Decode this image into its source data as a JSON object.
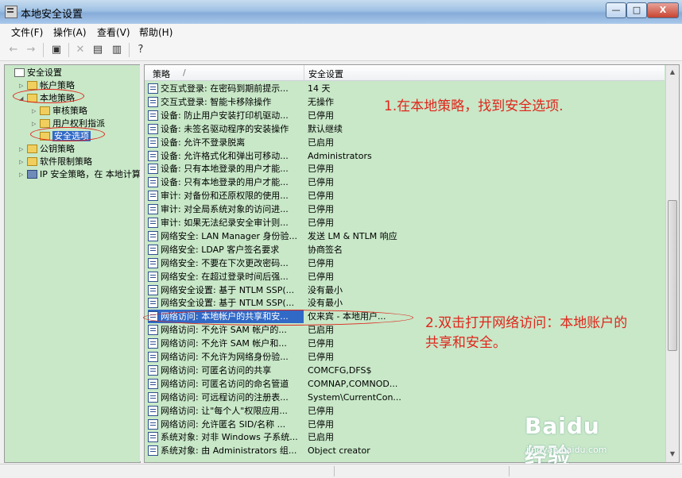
{
  "window": {
    "title": "本地安全设置"
  },
  "window_buttons": {
    "minimize": "—",
    "maximize": "□",
    "close": "X"
  },
  "menu": [
    "文件(F)",
    "操作(A)",
    "查看(V)",
    "帮助(H)"
  ],
  "toolbar_icons": [
    "back-arrow-icon",
    "forward-arrow-icon",
    "up-folder-icon",
    "delete-icon",
    "properties-icon",
    "export-list-icon",
    "help-icon"
  ],
  "tree": [
    {
      "label": "安全设置",
      "level": 0,
      "icon": "doc",
      "expander": ""
    },
    {
      "label": "帐户策略",
      "level": 1,
      "icon": "folder",
      "expander": "▷"
    },
    {
      "label": "本地策略",
      "level": 1,
      "icon": "folder",
      "expander": "◢"
    },
    {
      "label": "审核策略",
      "level": 2,
      "icon": "folder",
      "expander": "▷"
    },
    {
      "label": "用户权利指派",
      "level": 2,
      "icon": "folder",
      "expander": "▷"
    },
    {
      "label": "安全选项",
      "level": 2,
      "icon": "folder",
      "expander": "",
      "selected": true
    },
    {
      "label": "公钥策略",
      "level": 1,
      "icon": "folder",
      "expander": "▷"
    },
    {
      "label": "软件限制策略",
      "level": 1,
      "icon": "folder",
      "expander": "▷"
    },
    {
      "label": "IP 安全策略，在 本地计算机",
      "level": 1,
      "icon": "net",
      "expander": "▷"
    }
  ],
  "list": {
    "columns": [
      "策略",
      "安全设置"
    ],
    "sort_indicator": "/",
    "rows": [
      {
        "policy": "交互式登录: 在密码到期前提示...",
        "setting": "14 天"
      },
      {
        "policy": "交互式登录: 智能卡移除操作",
        "setting": "无操作"
      },
      {
        "policy": "设备: 防止用户安装打印机驱动...",
        "setting": "已停用"
      },
      {
        "policy": "设备: 未签名驱动程序的安装操作",
        "setting": "默认继续"
      },
      {
        "policy": "设备: 允许不登录脱离",
        "setting": "已启用"
      },
      {
        "policy": "设备: 允许格式化和弹出可移动...",
        "setting": "Administrators"
      },
      {
        "policy": "设备: 只有本地登录的用户才能...",
        "setting": "已停用"
      },
      {
        "policy": "设备: 只有本地登录的用户才能...",
        "setting": "已停用"
      },
      {
        "policy": "审计: 对备份和还原权限的使用...",
        "setting": "已停用"
      },
      {
        "policy": "审计: 对全局系统对象的访问进...",
        "setting": "已停用"
      },
      {
        "policy": "审计: 如果无法纪录安全审计则...",
        "setting": "已停用"
      },
      {
        "policy": "网络安全: LAN Manager 身份验...",
        "setting": "发送 LM & NTLM 响应"
      },
      {
        "policy": "网络安全: LDAP 客户签名要求",
        "setting": "协商签名"
      },
      {
        "policy": "网络安全: 不要在下次更改密码...",
        "setting": "已停用"
      },
      {
        "policy": "网络安全: 在超过登录时间后强...",
        "setting": "已停用"
      },
      {
        "policy": "网络安全设置: 基于 NTLM SSP(...",
        "setting": "没有最小"
      },
      {
        "policy": "网络安全设置: 基于 NTLM SSP(...",
        "setting": "没有最小"
      },
      {
        "policy": "网络访问: 本地帐户的共享和安...",
        "setting": "仅来宾 - 本地用户...",
        "selected": true
      },
      {
        "policy": "网络访问: 不允许 SAM 帐户的...",
        "setting": "已启用"
      },
      {
        "policy": "网络访问: 不允许 SAM 帐户和...",
        "setting": "已停用"
      },
      {
        "policy": "网络访问: 不允许为网络身份验...",
        "setting": "已停用"
      },
      {
        "policy": "网络访问: 可匿名访问的共享",
        "setting": "COMCFG,DFS$"
      },
      {
        "policy": "网络访问: 可匿名访问的命名管道",
        "setting": "COMNAP,COMNOD..."
      },
      {
        "policy": "网络访问: 可远程访问的注册表...",
        "setting": "System\\CurrentCon..."
      },
      {
        "policy": "网络访问: 让\"每个人\"权限应用...",
        "setting": "已停用"
      },
      {
        "policy": "网络访问: 允许匿名 SID/名称 ...",
        "setting": "已停用"
      },
      {
        "policy": "系统对象: 对非 Windows 子系统...",
        "setting": "已启用"
      },
      {
        "policy": "系统对象: 由 Administrators 组...",
        "setting": "Object creator"
      }
    ]
  },
  "annotations": {
    "step1": "1.在本地策略，找到安全选项.",
    "step2_line1": "2.双击打开网络访问：本地账户的",
    "step2_line2": "共享和安全。"
  },
  "watermark": {
    "logo": "Baidu经验",
    "url": "jingyan.baidu.com"
  },
  "colors": {
    "pane_bg": "#c8e8c8",
    "selection": "#3169c6",
    "annotation": "#e0251b"
  }
}
